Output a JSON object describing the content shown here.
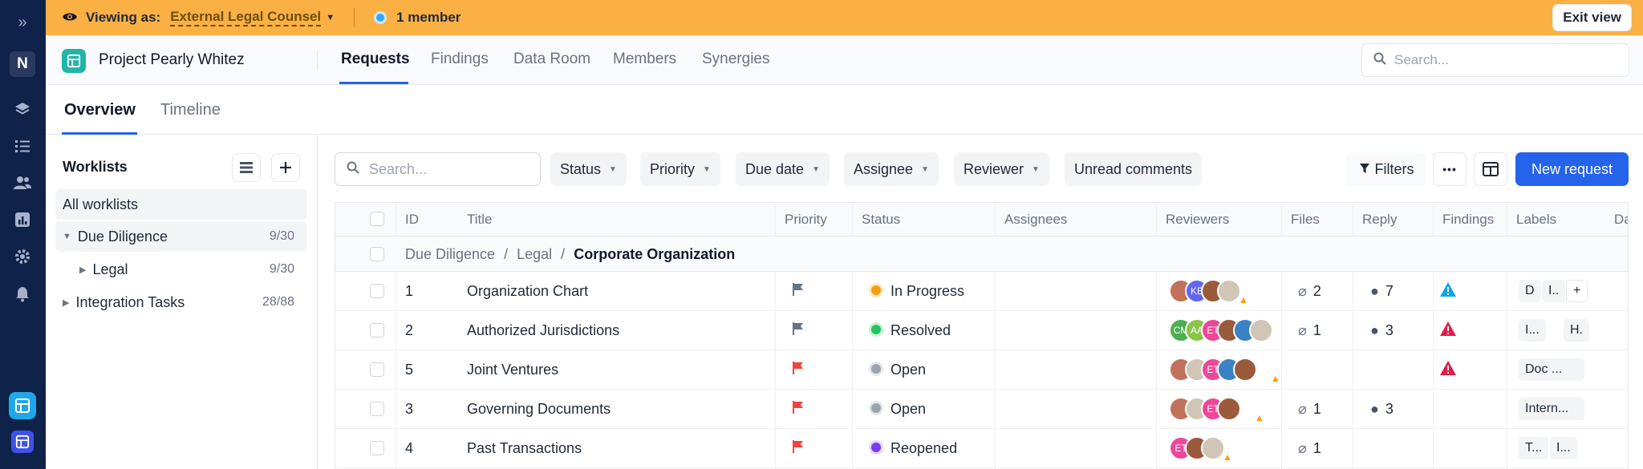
{
  "rail": {
    "items": [
      {
        "icon": "expand-icon",
        "glyph": "»"
      },
      {
        "icon": "workspace-avatar",
        "glyph": "N"
      },
      {
        "icon": "layers-icon",
        "glyph": "≋"
      },
      {
        "icon": "list-icon",
        "glyph": "☰"
      },
      {
        "icon": "users-icon",
        "glyph": "👥"
      },
      {
        "icon": "chart-icon",
        "glyph": "▥"
      },
      {
        "icon": "gear-icon",
        "glyph": "⚙"
      },
      {
        "icon": "bell-icon",
        "glyph": "🔔"
      },
      {
        "icon": "app-icon",
        "glyph": "◧"
      },
      {
        "icon": "app-icon-2",
        "glyph": "◧"
      }
    ]
  },
  "banner": {
    "viewing_label": "Viewing as:",
    "viewing_as": "External Legal Counsel",
    "members": "1 member",
    "exit_label": "Exit view"
  },
  "header": {
    "project_name": "Project Pearly Whitez",
    "tabs": [
      "Requests",
      "Findings",
      "Data Room",
      "Members",
      "Synergies"
    ],
    "search_placeholder": "Search..."
  },
  "subtabs": [
    "Overview",
    "Timeline"
  ],
  "sidebar": {
    "title": "Worklists",
    "items": [
      {
        "label": "All worklists",
        "count": ""
      },
      {
        "label": "Due Diligence",
        "count": "9/30"
      },
      {
        "label": "Legal",
        "count": "9/30"
      },
      {
        "label": "Integration Tasks",
        "count": "28/88"
      }
    ]
  },
  "toolbar": {
    "search_placeholder": "Search...",
    "filters": [
      "Status",
      "Priority",
      "Due date",
      "Assignee",
      "Reviewer"
    ],
    "unread": "Unread comments",
    "filters_btn": "Filters",
    "more": "•••",
    "new_request": "New request"
  },
  "table": {
    "columns": [
      "ID",
      "Title",
      "Priority",
      "Status",
      "Assignees",
      "Reviewers",
      "Files",
      "Reply",
      "Findings",
      "Labels",
      "Da"
    ],
    "group": {
      "p1": "Due Diligence",
      "p2": "Legal",
      "p3": "Corporate Organization",
      "sep": "/"
    },
    "rows": [
      {
        "id": "1",
        "title": "Organization Chart",
        "status": "In Progress",
        "files": "2",
        "reply": "7",
        "labels": [
          "D",
          "I..",
          "+"
        ]
      },
      {
        "id": "2",
        "title": "Authorized Jurisdictions",
        "status": "Resolved",
        "files": "1",
        "reply": "3",
        "labels": [
          "I...",
          "H."
        ]
      },
      {
        "id": "5",
        "title": "Joint Ventures",
        "status": "Open",
        "files": "",
        "reply": "",
        "labels": [
          "Doc ..."
        ]
      },
      {
        "id": "3",
        "title": "Governing Documents",
        "status": "Open",
        "files": "1",
        "reply": "3",
        "labels": [
          "Intern..."
        ]
      },
      {
        "id": "4",
        "title": "Past Transactions",
        "status": "Reopened",
        "files": "1",
        "reply": "",
        "labels": [
          "T...",
          "I..."
        ]
      }
    ],
    "reviewer_initials": {
      "kb": "KB",
      "cm": "CM",
      "aa": "AA",
      "et": "ET"
    }
  },
  "colors": {
    "banner": "#fbb044",
    "rail": "#0f2249",
    "primary": "#2563eb",
    "flag_gray": "#64748b",
    "flag_red": "#ef4444",
    "status_in_progress": "#f59e0b",
    "status_resolved": "#22c55e",
    "status_open": "#9ca3af",
    "status_reopened": "#7c3aed",
    "finding_blue": "#0ea5e9",
    "finding_red": "#e11d48"
  }
}
